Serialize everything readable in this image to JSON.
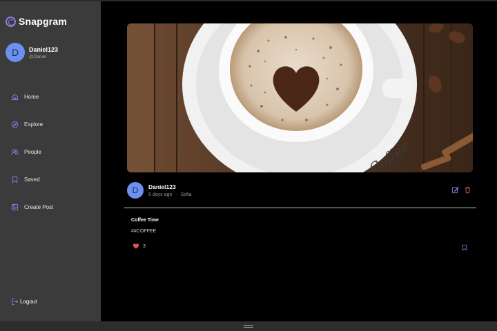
{
  "app": {
    "name": "Snapgram"
  },
  "user": {
    "initial": "D",
    "name": "Daniel123",
    "handle": "@Daniel"
  },
  "nav": [
    {
      "label": "Home",
      "icon": "home-icon"
    },
    {
      "label": "Explore",
      "icon": "explore-icon"
    },
    {
      "label": "People",
      "icon": "people-icon"
    },
    {
      "label": "Saved",
      "icon": "saved-icon"
    },
    {
      "label": "Create Post",
      "icon": "create-post-icon"
    }
  ],
  "logout_label": "Logout",
  "post": {
    "image_alt": "coffee cup with heart latte art",
    "author_initial": "D",
    "author": "Daniel123",
    "time": "5 days ago",
    "separator": "-",
    "location": "Sofia",
    "caption": "Coffee Time",
    "tags": "##COFFEE",
    "likes": "3"
  },
  "colors": {
    "accent": "#8f7fe6",
    "avatar": "#6c8ff0",
    "sidebar": "#3b3b3b",
    "like": "#e05454",
    "delete": "#e05454"
  }
}
